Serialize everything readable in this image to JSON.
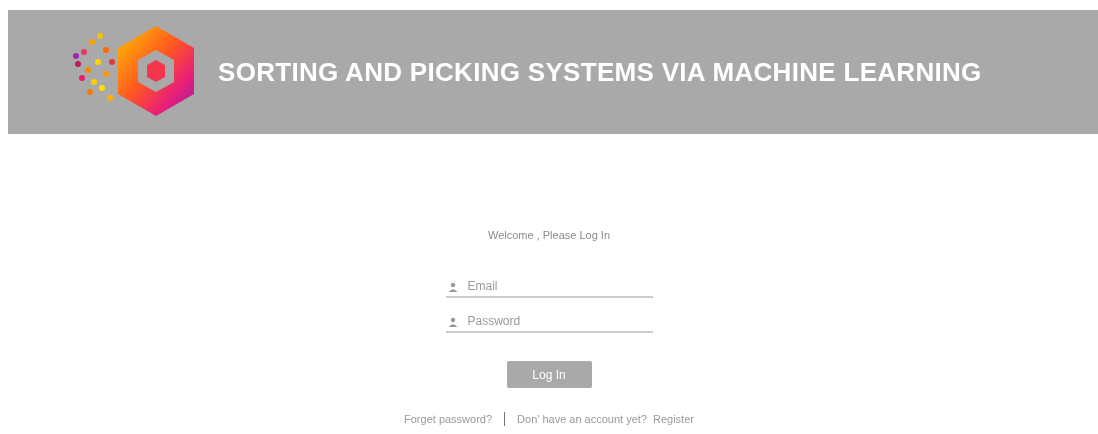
{
  "header": {
    "title": "SORTING AND PICKING SYSTEMS VIA MACHINE LEARNING"
  },
  "login": {
    "welcome": "Welcome , Please Log In",
    "fields": [
      {
        "placeholder": "Email"
      },
      {
        "placeholder": "Password"
      }
    ],
    "button": "Log In"
  },
  "footer": {
    "forgot": "Forget password?",
    "prompt": "Don' have an account yet?",
    "register": "Register"
  }
}
